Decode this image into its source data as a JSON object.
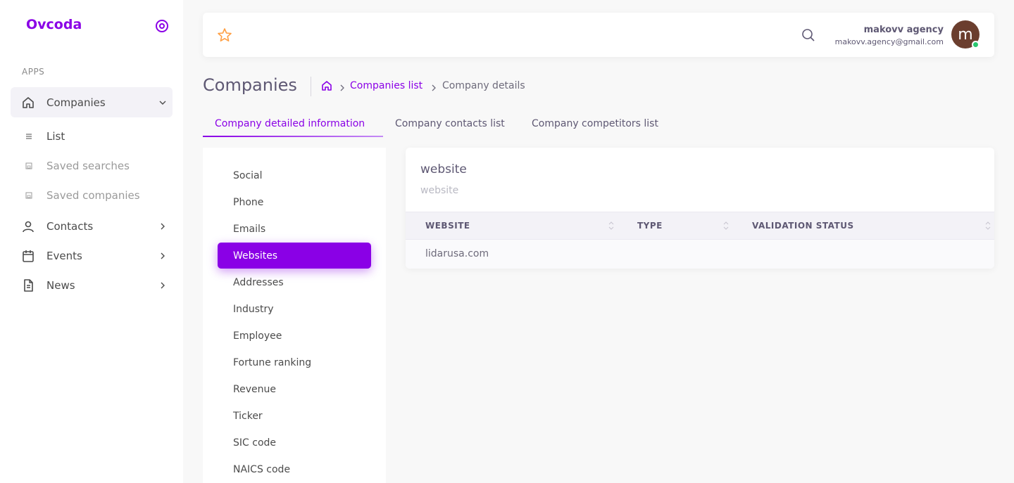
{
  "sidebar": {
    "brand": "Ovcoda",
    "section_label": "APPS",
    "nav": [
      {
        "label": "Companies",
        "icon": "home-icon"
      },
      {
        "label": "Contacts",
        "icon": "user-icon"
      },
      {
        "label": "Events",
        "icon": "calendar-icon"
      },
      {
        "label": "News",
        "icon": "file-text-icon"
      }
    ],
    "sub": [
      {
        "label": "List",
        "icon": "list-icon"
      },
      {
        "label": "Saved searches",
        "icon": "save-icon"
      },
      {
        "label": "Saved companies",
        "icon": "save-icon"
      }
    ]
  },
  "topbar": {
    "user_name": "makovv agency",
    "user_email": "makovv.agency@gmail.com",
    "avatar_initial": "m"
  },
  "header": {
    "title": "Companies",
    "breadcrumb_link": "Companies list",
    "breadcrumb_current": "Company details"
  },
  "tabs": [
    {
      "label": "Company detailed information",
      "active": true
    },
    {
      "label": "Company contacts list",
      "active": false
    },
    {
      "label": "Company competitors list",
      "active": false
    }
  ],
  "menu": [
    "Social",
    "Phone",
    "Emails",
    "Websites",
    "Addresses",
    "Industry",
    "Employee",
    "Fortune ranking",
    "Revenue",
    "Ticker",
    "SIC code",
    "NAICS code"
  ],
  "menu_active": "Websites",
  "card": {
    "title": "website",
    "subtitle": "website",
    "columns": [
      "WEBSITE",
      "TYPE",
      "VALIDATION STATUS"
    ],
    "rows": [
      [
        "lidarusa.com",
        "",
        ""
      ]
    ]
  },
  "colors": {
    "accent": "#8a00e6",
    "star": "#ff9f43",
    "online": "#28c76f",
    "avatar_bg": "#6b3e2e"
  }
}
